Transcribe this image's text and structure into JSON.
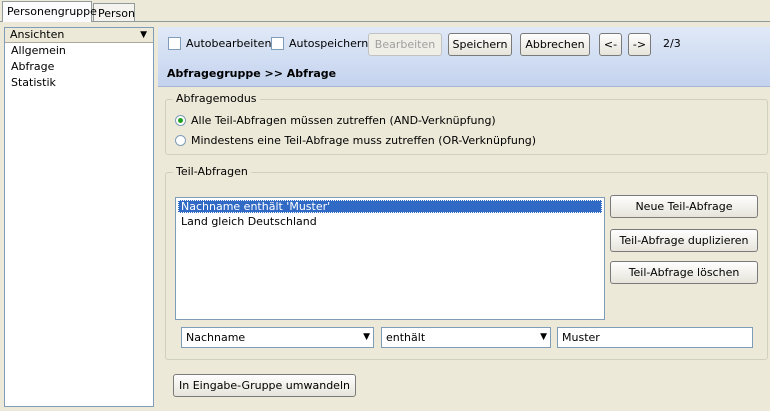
{
  "tabs": [
    {
      "label": "Personengruppe",
      "active": true
    },
    {
      "label": "Person",
      "active": false
    }
  ],
  "views_panel": {
    "title": "Ansichten",
    "pin_glyph": "⚓",
    "items": [
      "Allgemein",
      "Abfrage",
      "Statistik"
    ]
  },
  "toolbar": {
    "autoedit_label": "Autobearbeiten",
    "autosave_label": "Autospeichern",
    "edit_label": "Bearbeiten",
    "save_label": "Speichern",
    "cancel_label": "Abbrechen",
    "prev_label": "<-",
    "next_label": "->",
    "page_info": "2/3",
    "breadcrumb": "Abfragegruppe >> Abfrage"
  },
  "query_mode": {
    "legend": "Abfragemodus",
    "options": [
      {
        "label": "Alle Teil-Abfragen müssen zutreffen (AND-Verknüpfung)",
        "selected": true
      },
      {
        "label": "Mindestens eine Teil-Abfrage muss zutreffen (OR-Verknüpfung)",
        "selected": false
      }
    ]
  },
  "sub_queries": {
    "legend": "Teil-Abfragen",
    "items": [
      {
        "text": "Nachname enthält 'Muster'",
        "selected": true
      },
      {
        "text": "Land gleich Deutschland",
        "selected": false
      }
    ],
    "new_button": "Neue Teil-Abfrage",
    "duplicate_button": "Teil-Abfrage duplizieren",
    "delete_button": "Teil-Abfrage löschen",
    "field_select": "Nachname",
    "operator_select": "enthält",
    "value_input": "Muster"
  },
  "convert_button": "In Eingabe-Gruppe umwandeln",
  "colors": {
    "selection": "#316ac5",
    "toolbar_top": "#e0e9f7",
    "toolbar_bottom": "#c4d3ee",
    "radio_dot": "#21a121"
  }
}
